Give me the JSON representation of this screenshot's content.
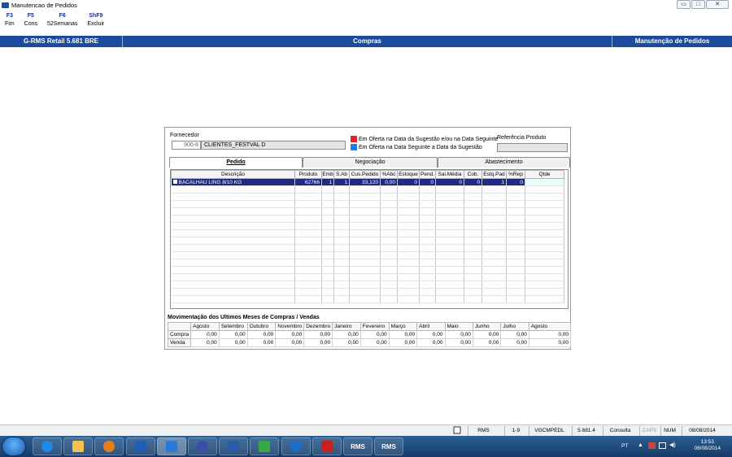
{
  "window": {
    "title": "Manutencao de Pedidos",
    "min": "▭",
    "max": "□",
    "close": "✕"
  },
  "fkeys": [
    {
      "key": "F3",
      "label": "Fim"
    },
    {
      "key": "F5",
      "label": "Cons"
    },
    {
      "key": "F6",
      "label": "52Semanas"
    },
    {
      "key": "ShF9",
      "label": "Excluir"
    }
  ],
  "header": {
    "left": "G-RMS Retail 5.681 BRE",
    "center": "Compras",
    "right": "Manutenção de Pedidos"
  },
  "fornecedor": {
    "label": "Fornecedor",
    "code": "900-8",
    "name": "CLIENTES_FESTVAL D"
  },
  "legend": [
    {
      "text": "Em Oferta na Data da Sugestão e/ou na Data Seguinte",
      "color": "#e0202a"
    },
    {
      "text": "Em Oferta na Data Seguinte a Data da Sugestão",
      "color": "#1e7de0"
    }
  ],
  "referencia": {
    "label": "Referência Produto",
    "value": ""
  },
  "tabs": [
    "Pedido",
    "Negociação",
    "Abastecimento"
  ],
  "grid": {
    "columns": [
      "Descrição",
      "Produto",
      "Emb",
      "S.Ab",
      "Cus.Pedido",
      "%Abc",
      "Estoque",
      "Pend.",
      "Sai.Média",
      "Cob.",
      "Estq.Pad",
      "%Rep",
      "Qtde"
    ],
    "rows": [
      [
        "BACALHAU LING 8/10 KG",
        "62766",
        "1",
        "1",
        "33,120",
        "0,00",
        "0",
        "0",
        "0",
        "0",
        "1",
        "0",
        ""
      ]
    ]
  },
  "movimentacao": {
    "title": "Movimentação dos Ultimos Meses de Compras / Vendas",
    "months": [
      "Agosto",
      "Setembro",
      "Outubro",
      "Novembro",
      "Dezembro",
      "Janeiro",
      "Fevereiro",
      "Março",
      "Abril",
      "Maio",
      "Junho",
      "Julho",
      "Agosto"
    ],
    "compra": {
      "label": "Compra",
      "values": [
        "0,00",
        "0,00",
        "0,00",
        "0,00",
        "0,00",
        "0,00",
        "0,00",
        "0,00",
        "0,00",
        "0,00",
        "0,00",
        "0,00",
        "0,00"
      ]
    },
    "venda": {
      "label": "Venda",
      "values": [
        "0,00",
        "0,00",
        "0,00",
        "0,00",
        "0,00",
        "0,00",
        "0,00",
        "0,00",
        "0,00",
        "0,00",
        "0,00",
        "0,00",
        "0,00"
      ]
    }
  },
  "status": [
    "RMS",
    "1-9",
    "VGCMPEDL",
    "5.681.4",
    "Consulta",
    "CAPS",
    "NUM",
    "08/08/2014"
  ],
  "taskbar": {
    "rms_label": "RMS",
    "tray_lang": "PT",
    "time": "13:53",
    "date": "08/08/2014"
  }
}
